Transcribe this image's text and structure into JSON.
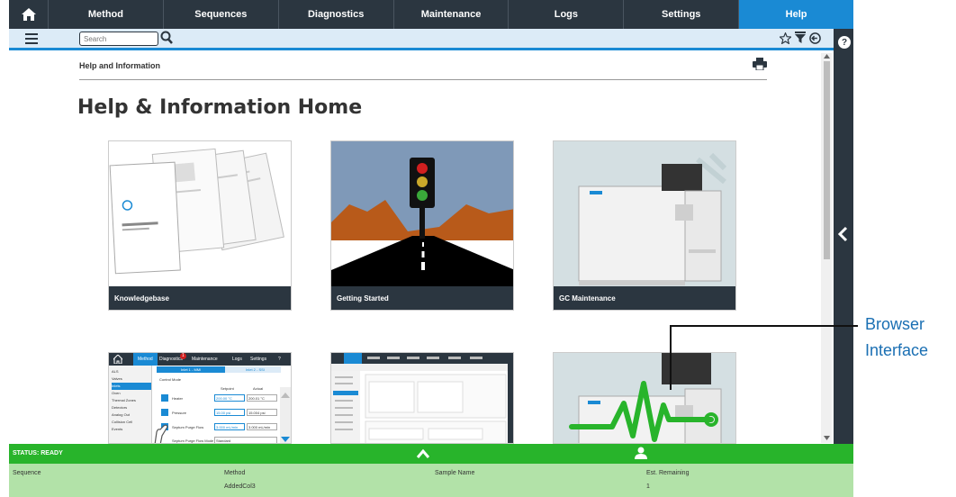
{
  "nav": {
    "tabs": [
      "Method",
      "Sequences",
      "Diagnostics",
      "Maintenance",
      "Logs",
      "Settings",
      "Help"
    ],
    "active": "Help"
  },
  "toolbar": {
    "search_placeholder": "Search"
  },
  "content": {
    "breadcrumb": "Help and Information",
    "title": "Help & Information Home",
    "cards": [
      "Knowledgebase",
      "Getting Started",
      "GC Maintenance"
    ]
  },
  "thumb1": {
    "tabs": [
      "Method",
      "Diagnostics",
      "Maintenance",
      "Logs",
      "Settings",
      "?"
    ],
    "badge": "1",
    "subtabs": [
      "Inlet 1 - MMI",
      "Inlet 2 - SSI"
    ],
    "section": "Control Mode",
    "col_setpoint": "Setpoint",
    "col_actual": "Actual",
    "sidebar": [
      "ALS",
      "Valves",
      "Inlets",
      "Oven",
      "Thermal Zones",
      "Detectors",
      "Analog Out",
      "Collision Cell",
      "Events"
    ],
    "rows": [
      {
        "label": "Heater",
        "setpoint": "200.00 °C",
        "actual": "200.01 °C"
      },
      {
        "label": "Pressure",
        "setpoint": "15.00 psi",
        "actual": "15.004 psi"
      },
      {
        "label": "Septum Purge Flow",
        "setpoint": "3.000 mL/min",
        "actual": "3.000 mL/min"
      },
      {
        "label": "Septum Purge Flow Mode",
        "setpoint": "Standard",
        "actual": ""
      }
    ]
  },
  "status": {
    "text": "STATUS: READY",
    "headers": [
      "Sequence",
      "Method",
      "Sample Name",
      "Est. Remaining"
    ],
    "values": [
      "",
      "AddedCol3",
      "",
      "1"
    ]
  },
  "callout": {
    "line1": "Browser",
    "line2": "Interface"
  },
  "colors": {
    "nav": "#2b3640",
    "accent": "#1a8ad4",
    "status": "#28b42b",
    "status_panel": "#b2e2a8",
    "callout": "#1a6fb3"
  },
  "icons": [
    "home-icon",
    "hamburger-icon",
    "search-icon",
    "star-icon",
    "filter-icon",
    "logout-icon",
    "help-icon",
    "print-icon",
    "chevron-left-icon",
    "chevron-up-icon",
    "person-icon"
  ]
}
